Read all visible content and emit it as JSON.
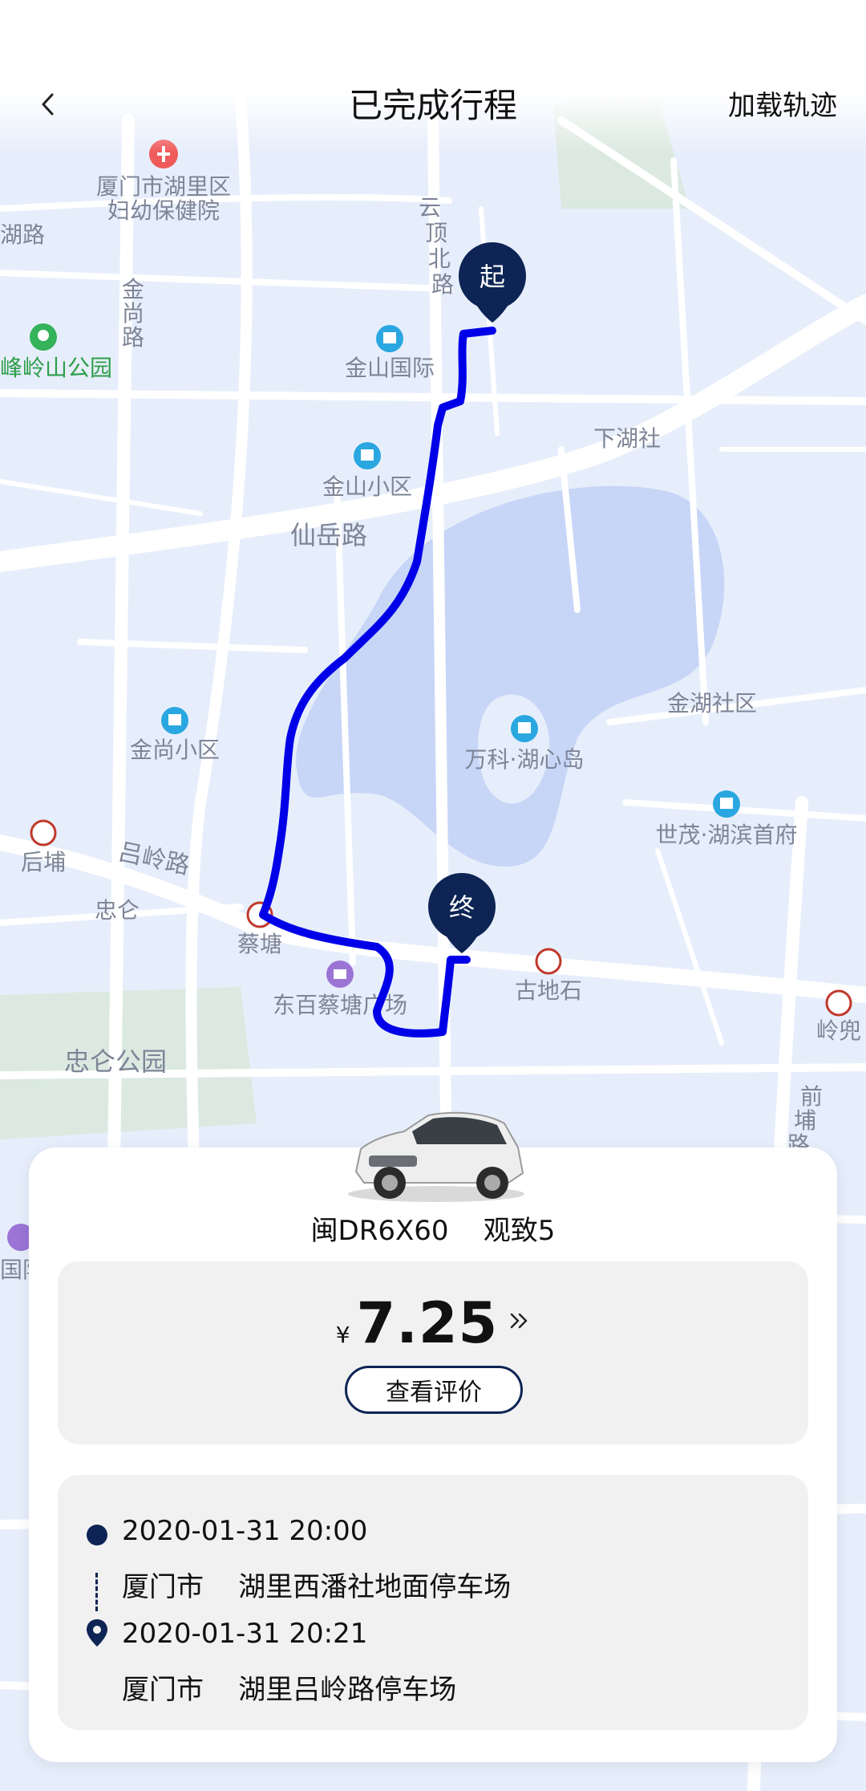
{
  "header": {
    "title": "已完成行程",
    "load_track_label": "加载轨迹"
  },
  "map": {
    "start_marker": "起",
    "end_marker": "终",
    "labels": {
      "hospital": [
        "厦门市湖里区",
        "妇幼保健院"
      ],
      "left_road": "湖路",
      "jinshang_road": [
        "金",
        "尚",
        "路"
      ],
      "yunding_road": [
        "云",
        "顶",
        "北",
        "路"
      ],
      "park_left": "峰岭山公园",
      "jinshan_intl": "金山国际",
      "xiahu": "下湖社",
      "jinshan_district": "金山小区",
      "xianyue_road": "仙岳路",
      "jinhu_district": "金湖社区",
      "jinshang_district": "金尚小区",
      "vanke": "万科·湖心岛",
      "houpu": "后埔",
      "lvling_road": "吕岭路",
      "shimao": "世茂·湖滨首府",
      "zhonglun": "忠仑",
      "caitang": "蔡塘",
      "gudishi": "古地石",
      "dongbai": "东百蔡塘广场",
      "lingdou": "岭兜",
      "zhonglun_park": "忠仑公园",
      "qianpu_road": [
        "前",
        "埔",
        "路"
      ],
      "guoji": "国际"
    }
  },
  "vehicle": {
    "plate": "闽DR6X60",
    "model": "观致5",
    "line": "闽DR6X60    观致5"
  },
  "fare": {
    "currency": "¥",
    "amount": "7.25",
    "more_icon": "double-chevron-right-icon",
    "review_label": "查看评价"
  },
  "trip": {
    "start_time": "2020-01-31 20:00",
    "start_city": "厦门市",
    "start_place": "湖里西潘社地面停车场",
    "start_line": "厦门市    湖里西潘社地面停车场",
    "end_time": "2020-01-31 20:21",
    "end_city": "厦门市",
    "end_place": "湖里吕岭路停车场",
    "end_line": "厦门市    湖里吕岭路停车场"
  },
  "colors": {
    "route": "#0000e8",
    "marker": "#0d2454",
    "map_bg": "#e7eefb",
    "lake": "#c7d6f7",
    "park": "#dbe9e1"
  }
}
